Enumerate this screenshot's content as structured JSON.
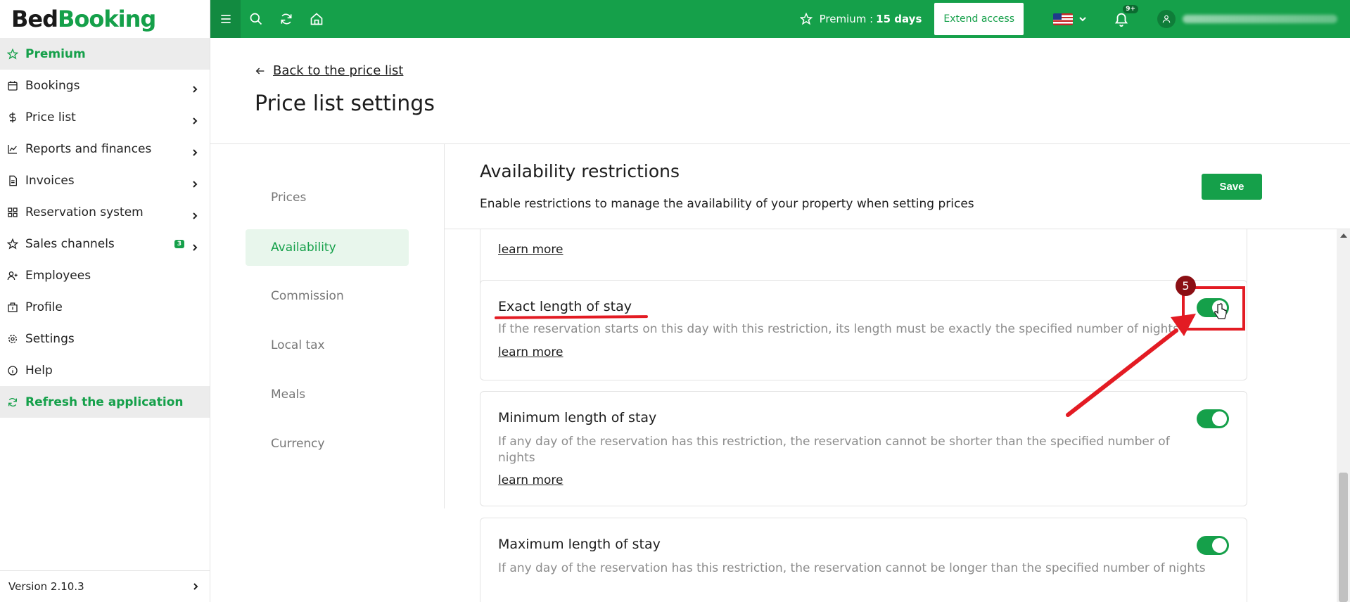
{
  "sidebar": {
    "logo_part1": "Bed",
    "logo_part2": "Booking",
    "items": [
      {
        "label": "Premium"
      },
      {
        "label": "Bookings"
      },
      {
        "label": "Price list"
      },
      {
        "label": "Reports and finances"
      },
      {
        "label": "Invoices"
      },
      {
        "label": "Reservation system"
      },
      {
        "label": "Sales channels",
        "badge": "3"
      },
      {
        "label": "Employees"
      },
      {
        "label": "Profile"
      },
      {
        "label": "Settings"
      },
      {
        "label": "Help"
      },
      {
        "label": "Refresh the application"
      }
    ],
    "version": "Version 2.10.3"
  },
  "topbar": {
    "premium_label": "Premium :",
    "premium_days": "15 days",
    "extend_label": "Extend access",
    "notification_count": "9+"
  },
  "header": {
    "back_label": "Back to the price list",
    "title": "Price list settings"
  },
  "tabs": [
    {
      "label": "Prices"
    },
    {
      "label": "Availability",
      "active": true
    },
    {
      "label": "Commission"
    },
    {
      "label": "Local tax"
    },
    {
      "label": "Meals"
    },
    {
      "label": "Currency"
    }
  ],
  "content": {
    "title": "Availability restrictions",
    "subtitle": "Enable restrictions to manage the availability of your property when setting prices",
    "save_label": "Save",
    "cards": [
      {
        "link": "learn more"
      },
      {
        "title": "Exact length of stay",
        "description": "If the reservation starts on this day with this restriction, its length must be exactly the specified number of nights",
        "link": "learn more",
        "enabled": true
      },
      {
        "title": "Minimum length of stay",
        "description": "If any day of the reservation has this restriction, the reservation cannot be shorter than the specified number of nights",
        "link": "learn more",
        "enabled": true
      },
      {
        "title": "Maximum length of stay",
        "description": "If any day of the reservation has this restriction, the reservation cannot be longer than the specified number of nights",
        "enabled": true
      }
    ]
  },
  "annotation": {
    "step_number": "5",
    "color": "#e31b23"
  },
  "colors": {
    "brand_green": "#15a04a",
    "active_tab_bg": "#e8f6ec"
  }
}
